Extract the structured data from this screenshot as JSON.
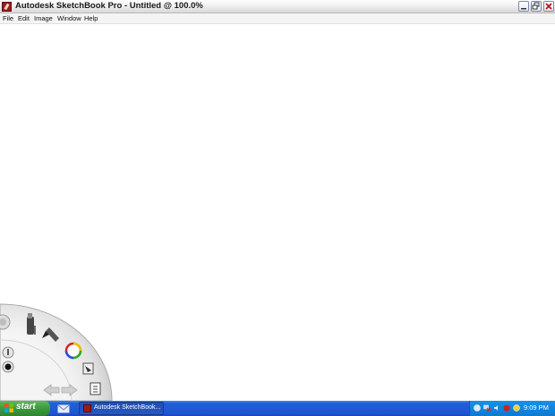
{
  "window": {
    "title": "Autodesk SketchBook Pro - Untitled @ 100.0%",
    "controls": [
      "minimize",
      "restore",
      "close"
    ]
  },
  "menu": {
    "items": [
      {
        "label": "File"
      },
      {
        "label": "Edit"
      },
      {
        "label": "Image"
      },
      {
        "label": "Window"
      },
      {
        "label": "Help"
      }
    ]
  },
  "lagoon": {
    "tools": [
      "pen-tool-icon",
      "brush-icon",
      "color-wheel-icon",
      "layer-icon",
      "document-icon",
      "undo-icon",
      "redo-icon",
      "brush-size-icon",
      "brush-dot-icon",
      "lagoon-menu-icon"
    ]
  },
  "taskbar": {
    "start_label": "start",
    "task_label": "Autodesk SketchBook...",
    "clock": "9:09 PM"
  },
  "colors": {
    "taskbar": "#245edb",
    "start": "#3c9a3c",
    "tray": "#0e79d0",
    "app_icon": "#9c1b1b"
  }
}
